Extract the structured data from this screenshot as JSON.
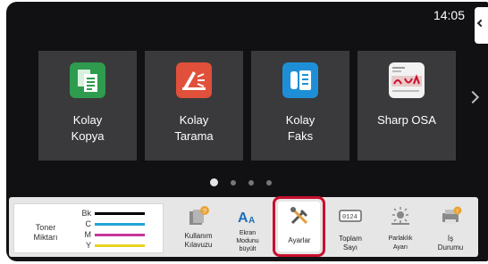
{
  "status": {
    "time": "14:05"
  },
  "apps": [
    {
      "line1": "Kolay",
      "line2": "Kopya",
      "icon": "copy-icon",
      "color": "#2e9b4e"
    },
    {
      "line1": "Kolay",
      "line2": "Tarama",
      "icon": "scan-icon",
      "color": "#e0503a"
    },
    {
      "line1": "Kolay",
      "line2": "Faks",
      "icon": "fax-icon",
      "color": "#1e8fd6"
    },
    {
      "line1": "Sharp OSA",
      "line2": "",
      "icon": "sharp-osa-icon",
      "color": "#f2f2f2"
    }
  ],
  "toner": {
    "title_line1": "Toner",
    "title_line2": "Miktarı",
    "rows": [
      {
        "label": "Bk",
        "color": "#000000"
      },
      {
        "label": "C",
        "color": "#21a5d8"
      },
      {
        "label": "M",
        "color": "#c8359a"
      },
      {
        "label": "Y",
        "color": "#e6d21f"
      }
    ]
  },
  "tools": {
    "guide": {
      "line1": "Kullanım",
      "line2": "Kılavuzu",
      "icon": "manual-icon"
    },
    "zoom": {
      "line1": "Ekran",
      "line2": "Modunu",
      "line3": "büyült",
      "icon": "text-size-icon"
    },
    "settings": {
      "line1": "Ayarlar",
      "icon": "settings-icon"
    },
    "counter": {
      "line1": "Toplam",
      "line2": "Sayı",
      "counter_text": "0124",
      "icon": "counter-icon"
    },
    "brightness": {
      "line1": "Parlaklık",
      "line2": "Ayarı",
      "icon": "brightness-icon"
    },
    "job": {
      "line1": "İş",
      "line2": "Durumu",
      "icon": "job-status-icon"
    }
  },
  "colors": {
    "highlight": "#c8102e",
    "background": "#111113",
    "tile": "#3a3a3c"
  }
}
